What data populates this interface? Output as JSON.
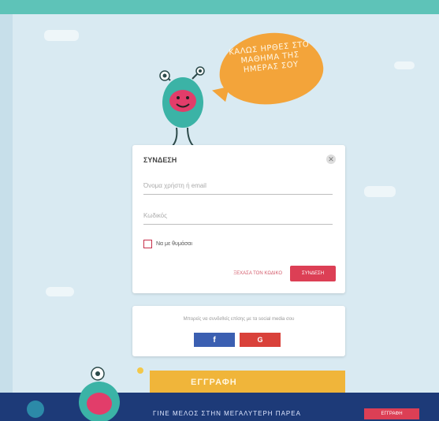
{
  "bubble": {
    "text": "ΚΑΛΩΣ ΗΡΘΕΣ ΣΤΟ ΜΑΘΗΜΑ ΤΗΣ ΗΜΕΡΑΣ ΣΟΥ"
  },
  "login": {
    "title": "ΣΥΝΔΕΣΗ",
    "username_placeholder": "Όνομα χρήστη ή email",
    "password_placeholder": "Κωδικός",
    "remember_label": "Να με θυμάσαι",
    "forgot_label": "ΞΕΧΑΣΑ ΤΟΝ ΚΩΔΙΚΟ",
    "submit_label": "ΣΥΝΔΕΣΗ"
  },
  "social": {
    "text": "Μπορείς να συνδεθείς επίσης με τα social media σου",
    "facebook_label": "f",
    "google_label": "G"
  },
  "register": {
    "label": "ΕΓΓΡΑΦΗ"
  },
  "bottom": {
    "text": "ΓΙΝΕ ΜΕΛΟΣ ΣΤΗΝ ΜΕΓΑΛΥΤΕΡΗ ΠΑΡΕΑ",
    "button": "ΕΓΓΡΑΦΗ"
  },
  "colors": {
    "accent": "#dc3f55",
    "topbar": "#5ec3b8",
    "facebook": "#3b5fb1",
    "google": "#d9413a",
    "banner": "#1d3a78"
  },
  "icons": {
    "close": "close-icon",
    "monster": "monster-mascot-icon"
  }
}
